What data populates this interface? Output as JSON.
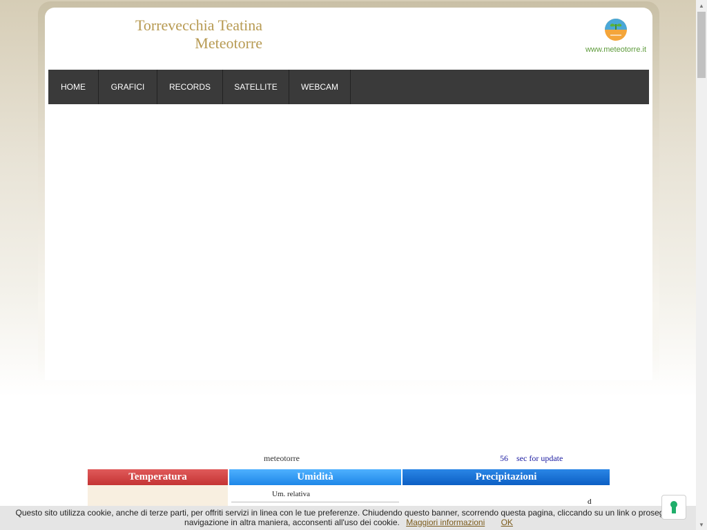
{
  "header": {
    "title_line1": "Torrevecchia Teatina",
    "title_line2": "Meteotorre",
    "logo_text": "www.meteotorre.it"
  },
  "nav": {
    "items": [
      {
        "label": "HOME"
      },
      {
        "label": "GRAFICI"
      },
      {
        "label": "RECORDS"
      },
      {
        "label": "SATELLITE"
      },
      {
        "label": "WEBCAM"
      }
    ]
  },
  "status": {
    "brand": "meteotorre",
    "seconds": "56",
    "seconds_label": "sec for update"
  },
  "table": {
    "headers": [
      "Temperatura",
      "Umidità",
      "Precipitazioni"
    ],
    "humidity_label": "Um. relativa",
    "precip_letter": "d"
  },
  "cookie": {
    "text_line1": "Questo sito utilizza cookie, anche di terze parti, per offriti servizi in linea con le tue preferenze. Chiudendo questo banner, scorrendo questa pagina, cliccando su un link o prosegue la",
    "text_line2": "navigazione in altra maniera, acconsenti all'uso dei cookie.",
    "more_info": "Maggiori informazioni",
    "ok": "OK"
  },
  "colors": {
    "title": "#b79a52",
    "nav_bg": "#3a3a3a",
    "temperature": "#d04444",
    "humidity": "#2f99f5",
    "precipitation": "#1470d6"
  },
  "icons": {
    "logo": "sprout-globe-icon",
    "cookie_settings": "keyhole-icon"
  }
}
